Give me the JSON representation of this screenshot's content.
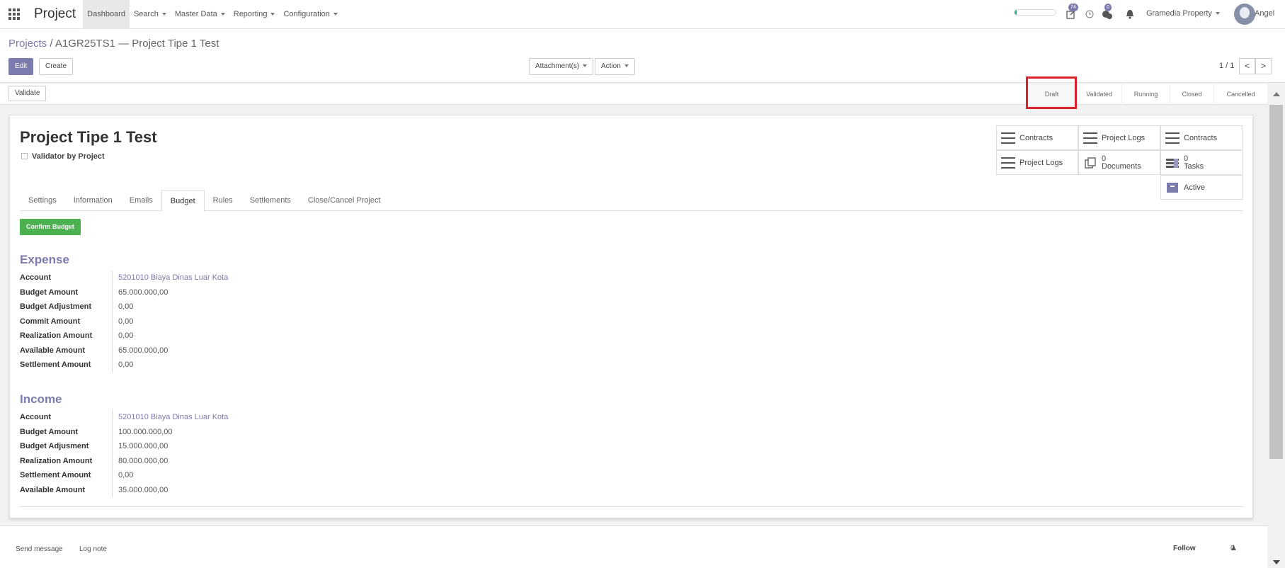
{
  "topbar": {
    "app_title": "Project",
    "menu": [
      {
        "label": "Dashboard",
        "active": true,
        "caret": false
      },
      {
        "label": "Search",
        "caret": true
      },
      {
        "label": "Master Data",
        "caret": true
      },
      {
        "label": "Reporting",
        "caret": true
      },
      {
        "label": "Configuration",
        "caret": true
      }
    ],
    "progress": 0.05,
    "activity_count": "74",
    "message_count": "0",
    "company": "Gramedia Property",
    "user": "Angel",
    "colors": {
      "accent": "#7c7bad",
      "progress": "#21b799",
      "confirm": "#4caf50",
      "highlight": "#d9232a"
    }
  },
  "control_panel": {
    "breadcrumb_parent": "Projects",
    "breadcrumb_sep": "/",
    "breadcrumb_current": "A1GR25TS1 — Project Tipe 1 Test",
    "edit_label": "Edit",
    "create_label": "Create",
    "attachments_label": "Attachment(s)",
    "action_label": "Action",
    "pager": "1 / 1",
    "prev": "<",
    "next": ">"
  },
  "statusbar": {
    "validate_label": "Validate",
    "stages": [
      "Draft",
      "Validated",
      "Running",
      "Closed",
      "Cancelled"
    ],
    "current_stage": "Draft"
  },
  "form": {
    "title": "Project Tipe 1 Test",
    "validator_label": "Validator by Project",
    "smart_buttons": {
      "contracts_1": "Contracts",
      "project_logs_1": "Project Logs",
      "contracts_2": "Contracts",
      "project_logs_2": "Project Logs",
      "documents_count": "0",
      "documents_label": "Documents",
      "tasks_count": "0",
      "tasks_label": "Tasks",
      "active_label": "Active"
    },
    "tabs": [
      "Settings",
      "Information",
      "Emails",
      "Budget",
      "Rules",
      "Settlements",
      "Close/Cancel Project"
    ],
    "active_tab": "Budget",
    "confirm_label": "Confirm Budget",
    "expense": {
      "title": "Expense",
      "rows": [
        {
          "label": "Account",
          "value": "5201010 Biaya Dinas Luar Kota"
        },
        {
          "label": "Budget Amount",
          "value": "65.000.000,00"
        },
        {
          "label": "Budget Adjustment",
          "value": "0,00"
        },
        {
          "label": "Commit Amount",
          "value": "0,00"
        },
        {
          "label": "Realization Amount",
          "value": "0,00"
        },
        {
          "label": "Available Amount",
          "value": "65.000.000,00"
        },
        {
          "label": "Settlement Amount",
          "value": "0,00"
        }
      ]
    },
    "income": {
      "title": "Income",
      "rows": [
        {
          "label": "Account",
          "value": "5201010 Biaya Dinas Luar Kota"
        },
        {
          "label": "Budget Amount",
          "value": "100.000.000,00"
        },
        {
          "label": "Budget Adjusment",
          "value": "15.000.000,00"
        },
        {
          "label": "Realization Amount",
          "value": "80.000.000,00"
        },
        {
          "label": "Settlement Amount",
          "value": "0,00"
        },
        {
          "label": "Available Amount",
          "value": "35.000.000,00"
        }
      ]
    }
  },
  "chatter": {
    "send_message": "Send message",
    "log_note": "Log note",
    "follow": "Follow",
    "followers": "0"
  }
}
